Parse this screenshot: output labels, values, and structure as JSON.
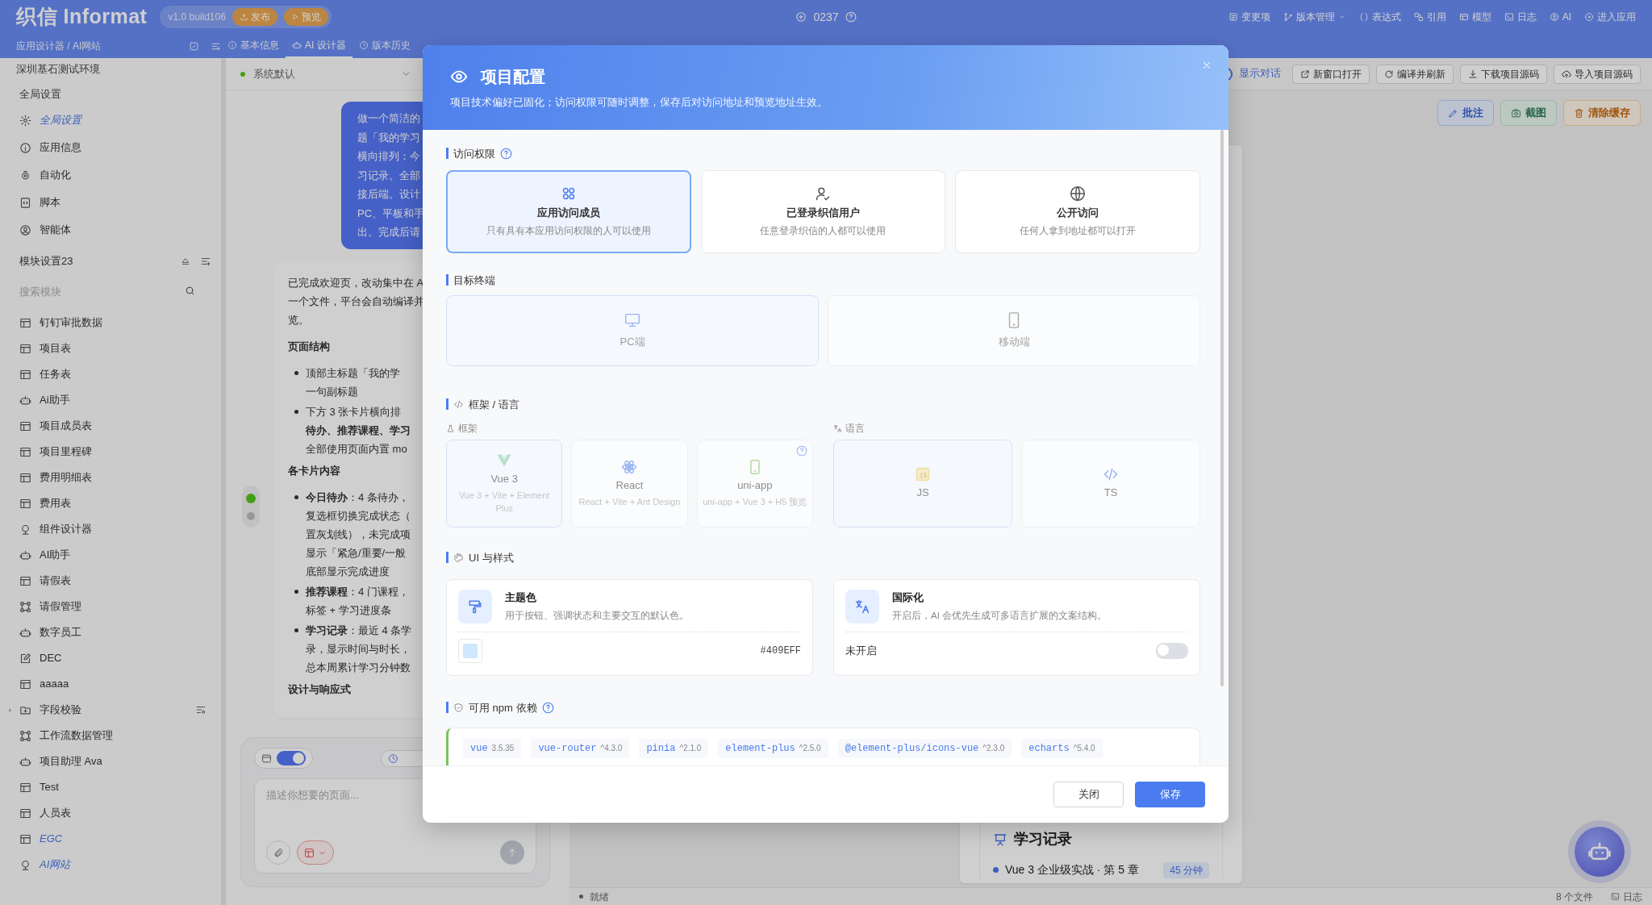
{
  "topbar": {
    "logo": "织信 Informat",
    "version": "v1.0 build106",
    "publish": "发布",
    "preview": "预览",
    "counter": "0237",
    "actions": [
      "变更项",
      "版本管理",
      "表达式",
      "引用",
      "模型",
      "日志",
      "AI",
      "进入应用"
    ]
  },
  "subbar": {
    "breadcrumb": "应用设计器 / AI网站",
    "tabs": [
      {
        "label": "基本信息",
        "selected": false
      },
      {
        "label": "AI 设计器",
        "selected": true
      },
      {
        "label": "版本历史",
        "selected": false
      }
    ]
  },
  "sidebar": {
    "environment": "深圳基石测试环境",
    "global_title": "全局设置",
    "global_items": [
      {
        "label": "全局设置",
        "kind": "gear",
        "selected": true
      },
      {
        "label": "应用信息",
        "kind": "info",
        "selected": false
      },
      {
        "label": "自动化",
        "kind": "automation",
        "selected": false
      },
      {
        "label": "脚本",
        "kind": "script",
        "selected": false
      },
      {
        "label": "智能体",
        "kind": "agent",
        "selected": false
      }
    ],
    "module_title": "模块设置23",
    "search_placeholder": "搜索模块",
    "modules": [
      {
        "label": "钉钉审批数据",
        "kind": "table",
        "selected": false
      },
      {
        "label": "项目表",
        "kind": "table",
        "selected": false
      },
      {
        "label": "任务表",
        "kind": "table",
        "selected": false
      },
      {
        "label": "Ai助手",
        "kind": "robot",
        "selected": false
      },
      {
        "label": "项目成员表",
        "kind": "table",
        "selected": false
      },
      {
        "label": "项目里程碑",
        "kind": "table",
        "selected": false
      },
      {
        "label": "费用明细表",
        "kind": "table",
        "selected": false
      },
      {
        "label": "费用表",
        "kind": "table",
        "selected": false
      },
      {
        "label": "组件设计器",
        "kind": "designer",
        "selected": false
      },
      {
        "label": "AI助手",
        "kind": "robot",
        "selected": false
      },
      {
        "label": "请假表",
        "kind": "table",
        "selected": false
      },
      {
        "label": "请假管理",
        "kind": "flow",
        "selected": false
      },
      {
        "label": "数字员工",
        "kind": "robot",
        "selected": false
      },
      {
        "label": "DEC",
        "kind": "edit",
        "selected": false
      },
      {
        "label": "aaaaa",
        "kind": "table",
        "selected": false
      },
      {
        "label": "字段校验",
        "kind": "folder",
        "selected": false
      },
      {
        "label": "工作流数据管理",
        "kind": "flow",
        "selected": false
      },
      {
        "label": "项目助理 Ava",
        "kind": "robot",
        "selected": false
      },
      {
        "label": "Test",
        "kind": "table",
        "selected": false
      },
      {
        "label": "人员表",
        "kind": "table",
        "selected": false
      },
      {
        "label": "EGC",
        "kind": "table",
        "selected": true
      },
      {
        "label": "AI网站",
        "kind": "designer",
        "selected": true
      }
    ]
  },
  "chat": {
    "model": "系统默认",
    "view_modes": [
      {
        "selected": true
      },
      {
        "selected": false
      }
    ],
    "user_message": [
      "做一个简洁的",
      "题「我的学习",
      "横向排列：今",
      "习记录。全部",
      "接后端。设计",
      "PC、平板和手",
      "出。完成后请"
    ],
    "assistant": [
      {
        "kind": "p",
        "lines": [
          "已完成欢迎页，改动集中在 A",
          "一个文件，平台会自动编译并",
          "览。"
        ]
      },
      {
        "kind": "h",
        "lines": [
          "页面结构"
        ]
      },
      {
        "kind": "li",
        "lines": [
          "顶部主标题「我的学",
          "一句副标题"
        ]
      },
      {
        "kind": "li",
        "lines": [
          "下方 3 张卡片横向排",
          "**待办、推荐课程、学习**",
          "全部使用页面内置 mo"
        ]
      },
      {
        "kind": "h",
        "lines": [
          "各卡片内容"
        ]
      },
      {
        "kind": "li",
        "lines": [
          "**今日待办**：4 条待办，",
          "复选框切换完成状态（",
          "置灰划线），未完成项",
          "显示「紧急/重要/一般",
          "底部显示完成进度"
        ]
      },
      {
        "kind": "li",
        "lines": [
          "**推荐课程**：4 门课程，",
          "标签 + 学习进度条"
        ]
      },
      {
        "kind": "li",
        "lines": [
          "**学习记录**：最近 4 条学",
          "录，显示时间与时长，",
          "总本周累计学习分钟数"
        ]
      },
      {
        "kind": "h",
        "lines": [
          "设计与响应式"
        ]
      }
    ],
    "composer": {
      "toggle_on": true,
      "placeholder": "描述你想要的页面..."
    }
  },
  "preview": {
    "show_chat_on": true,
    "show_chat_label": "显示对话",
    "tools": [
      "新窗口打开",
      "编译并刷新",
      "下载项目源码",
      "导入项目源码"
    ],
    "actions": [
      {
        "label": "批注",
        "kind": "annotate"
      },
      {
        "label": "截图",
        "kind": "screenshot"
      },
      {
        "label": "清除缓存",
        "kind": "clear"
      }
    ],
    "record_title": "学习记录",
    "record_item": "Vue 3 企业级实战 · 第 5 章",
    "record_duration": "45 分钟"
  },
  "status_bar": {
    "state": "就绪",
    "files": "8 个文件",
    "log": "日志"
  },
  "modal": {
    "title": "项目配置",
    "subtitle": "项目技术偏好已固化；访问权限可随时调整，保存后对访问地址和预览地址生效。",
    "access": {
      "title": "访问权限",
      "options": [
        {
          "title": "应用访问成员",
          "desc": "只有具有本应用访问权限的人可以使用",
          "selected": true
        },
        {
          "title": "已登录织信用户",
          "desc": "任意登录织信的人都可以使用",
          "selected": false
        },
        {
          "title": "公开访问",
          "desc": "任何人拿到地址都可以打开",
          "selected": false
        }
      ]
    },
    "terminal": {
      "title": "目标终端",
      "disabled": true,
      "options": [
        {
          "label": "PC端",
          "selected": true
        },
        {
          "label": "移动端",
          "selected": false
        }
      ]
    },
    "stack": {
      "title": "框架 / 语言",
      "disabled": true,
      "framework_label": "框架",
      "frameworks": [
        {
          "name": "Vue 3",
          "desc": "Vue 3 + Vite + Element Plus",
          "selected": true
        },
        {
          "name": "React",
          "desc": "React + Vite + Ant Design",
          "selected": false
        },
        {
          "name": "uni-app",
          "desc": "uni-app + Vue 3 + H5 预览",
          "selected": false
        }
      ],
      "language_label": "语言",
      "languages": [
        {
          "name": "JS",
          "selected": true
        },
        {
          "name": "TS",
          "selected": false
        }
      ]
    },
    "ui": {
      "title": "UI 与样式",
      "theme": {
        "title": "主题色",
        "desc": "用于按钮、强调状态和主要交互的默认色。",
        "value": "#409EFF"
      },
      "i18n": {
        "title": "国际化",
        "desc": "开启后，AI 会优先生成可多语言扩展的文案结构。",
        "status": "未开启",
        "on": false
      }
    },
    "npm": {
      "title": "可用 npm 依赖",
      "packages": [
        {
          "name": "vue",
          "version": "3.5.35"
        },
        {
          "name": "vue-router",
          "version": "^4.3.0"
        },
        {
          "name": "pinia",
          "version": "^2.1.0"
        },
        {
          "name": "element-plus",
          "version": "^2.5.0"
        },
        {
          "name": "@element-plus/icons-vue",
          "version": "^2.3.0"
        },
        {
          "name": "echarts",
          "version": "^5.4.0"
        }
      ]
    },
    "buttons": {
      "close": "关闭",
      "save": "保存"
    }
  }
}
